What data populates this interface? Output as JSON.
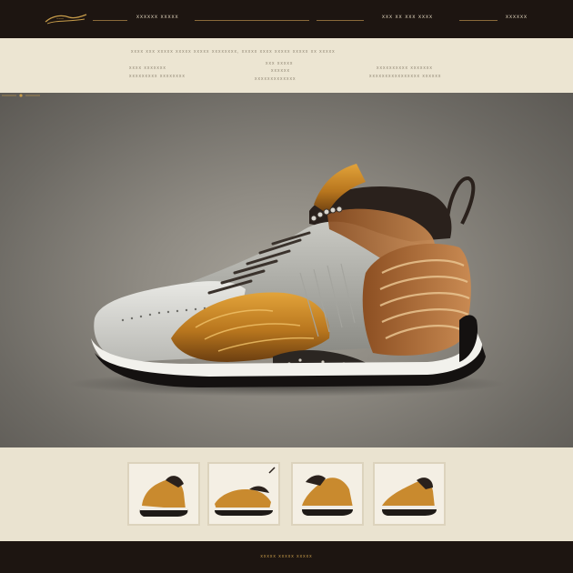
{
  "header": {
    "brand_logo_icon": "script-logo-icon",
    "nav_left": "xxxxxx  xxxxx",
    "nav_right": "xxx  xx  xxx  xxxx",
    "nav_far_right": "xxxxxx"
  },
  "banner": {
    "headline": "xxxx  xxx  xxxxx xxxxx xxxxx xxxxxxxx,  xxxxx xxxx xxxxx xxxxx  xx  xxxxx",
    "col_left_1": "xxxx xxxxxxx",
    "col_left_2": "xxxxxxxxx xxxxxxxx",
    "col_center_1": "xxx xxxxx",
    "col_center_2": "xxxxxx",
    "col_center_3": "xxxxxxxxxxxxx",
    "col_right_1": "xxxxxxxxxx xxxxxxx",
    "col_right_2": "xxxxxxxxxxxxxxxx xxxxxx"
  },
  "hero": {
    "product_image_icon": "sneaker-hero-image",
    "caption_icon": "ornament-caption-icon"
  },
  "thumbnails": [
    {
      "icon": "sneaker-thumb-icon"
    },
    {
      "icon": "sneaker-thumb-icon"
    },
    {
      "icon": "sneaker-thumb-icon"
    },
    {
      "icon": "sneaker-thumb-icon"
    }
  ],
  "footer": {
    "text": "xxxxx xxxxx xxxxx"
  },
  "colors": {
    "dark": "#1d1511",
    "cream": "#ece5d2",
    "gold": "#c79c4a",
    "amber": "#b8761e",
    "grey": "#8f8b83"
  }
}
